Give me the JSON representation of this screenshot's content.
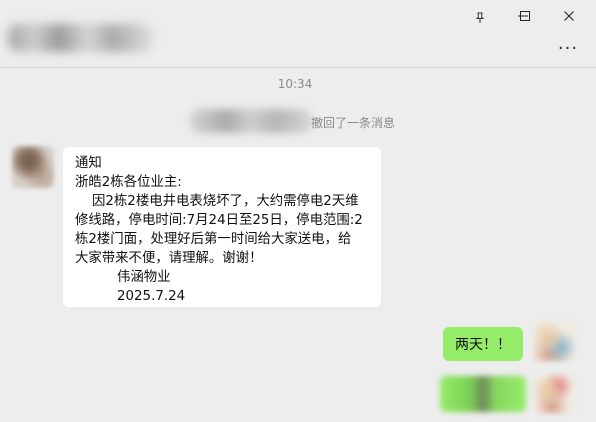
{
  "window": {
    "pin_icon": "pin-icon",
    "minimize_label": "—",
    "maximize_label": "☐",
    "close_label": "✕",
    "more_label": "···"
  },
  "chat": {
    "time": "10:34",
    "recall_text": "撤回了一条消息",
    "notice": {
      "line1": "通知",
      "line2": "浙皓2栋各位业主:",
      "line3": "因2栋2楼电井电表烧坏了，大约需停电2天维",
      "line4": "修线路，停电时间:7月24日至25日，停电范围:2",
      "line5": "栋2楼门面，处理好后第一时间给大家送电，给",
      "line6": "大家带来不便，请理解。谢谢！",
      "signature": "伟涵物业",
      "date": "2025.7.24"
    },
    "reply": "两天！！"
  }
}
